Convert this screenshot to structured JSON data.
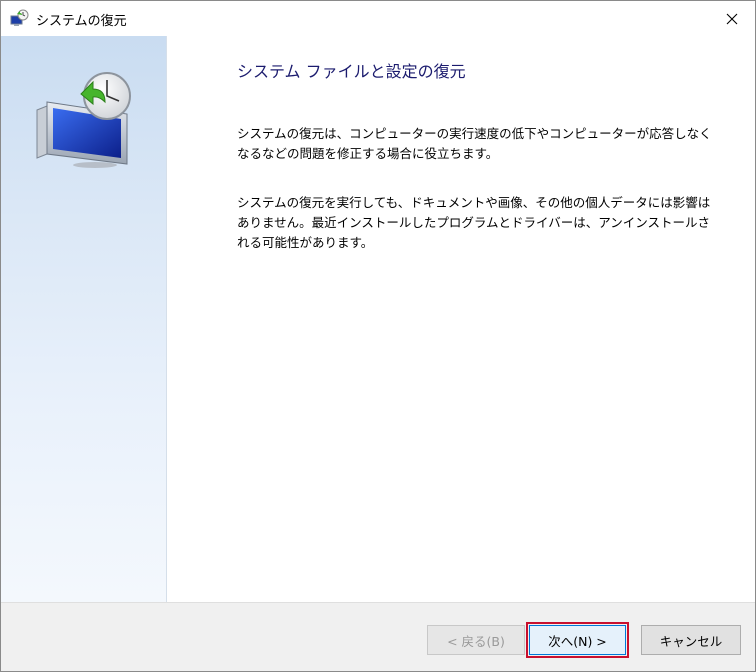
{
  "window": {
    "title": "システムの復元"
  },
  "icons": {
    "title_icon": "system-restore-icon",
    "close_icon": "close-icon",
    "sidebar_art": "system-restore-monitor-clock-icon"
  },
  "content": {
    "heading": "システム ファイルと設定の復元",
    "paragraph1": "システムの復元は、コンピューターの実行速度の低下やコンピューターが応答しなくなるなどの問題を修正する場合に役立ちます。",
    "paragraph2": "システムの復元を実行しても、ドキュメントや画像、その他の個人データには影響はありません。最近インストールしたプログラムとドライバーは、アンインストールされる可能性があります。"
  },
  "footer": {
    "back_label": "< 戻る(B)",
    "next_label": "次へ(N) >",
    "cancel_label": "キャンセル"
  },
  "colors": {
    "heading": "#1b1b6e",
    "sidebar_top": "#c9dcf1",
    "focus_highlight": "#c8102e"
  }
}
